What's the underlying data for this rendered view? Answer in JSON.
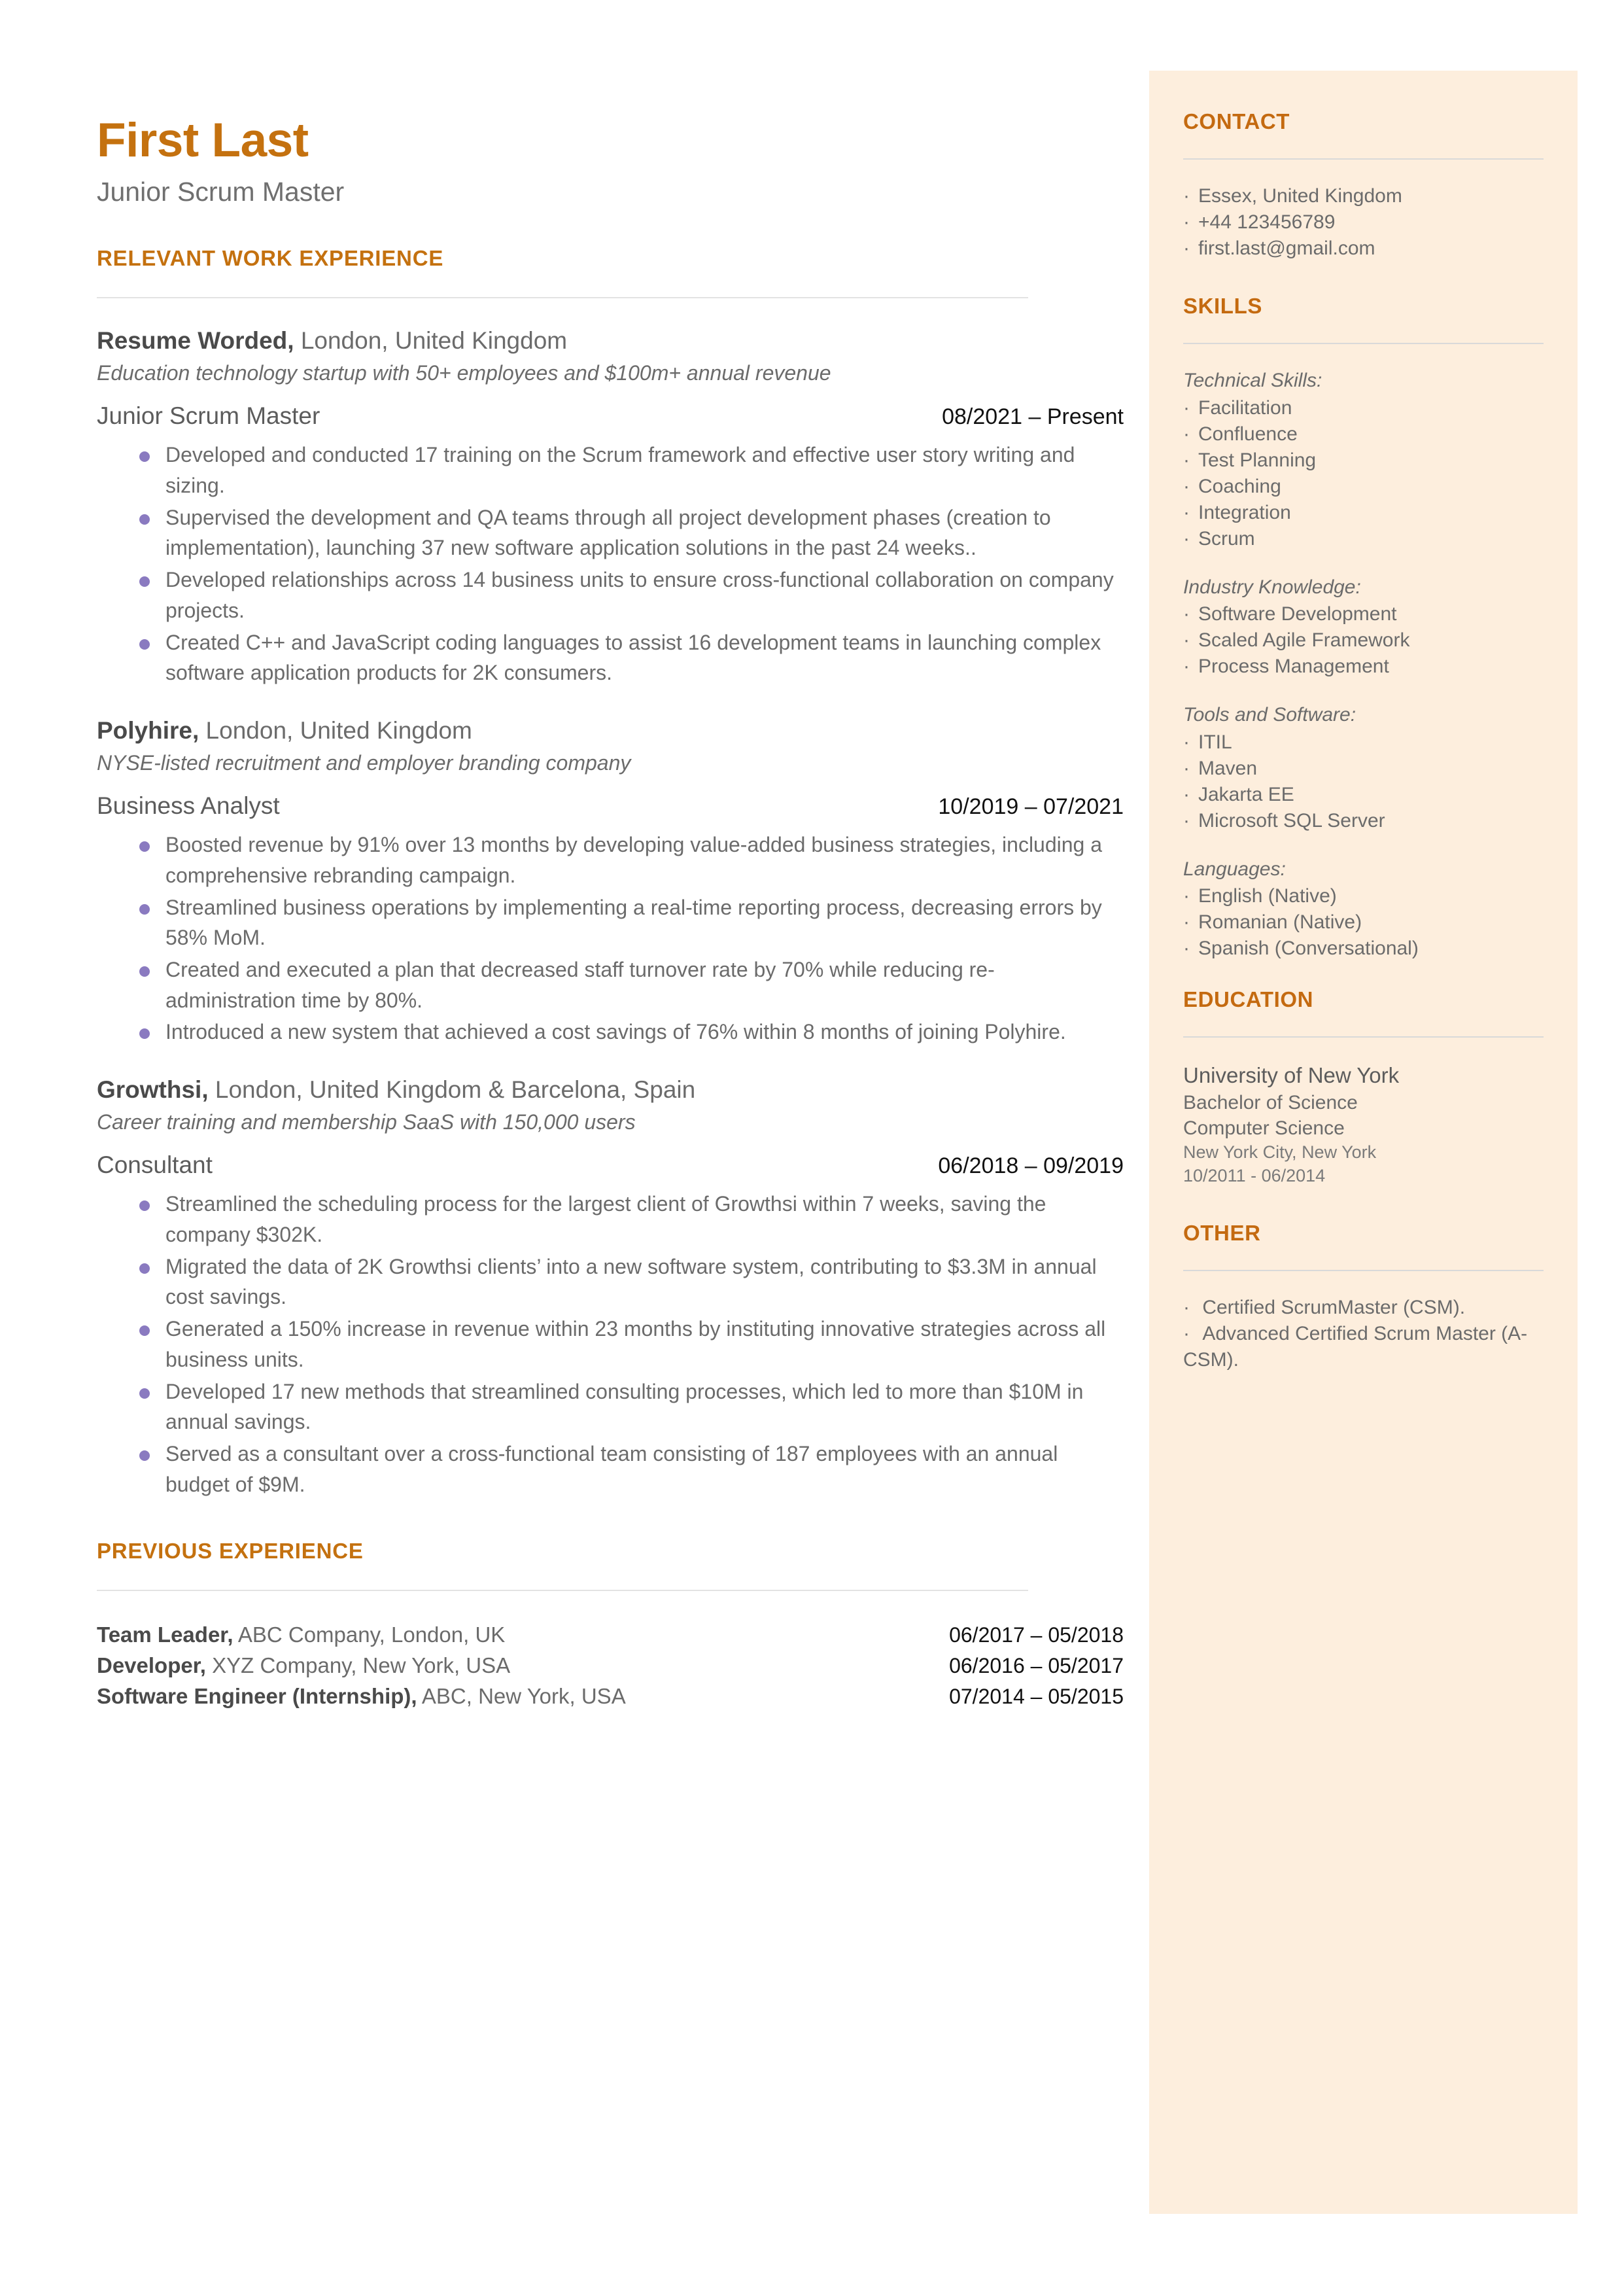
{
  "colors": {
    "accent": "#c4710f",
    "sidebar_bg": "#fdeedd",
    "bullet": "#8a7ac0",
    "body_text": "#6b6b6b",
    "date_text": "#111111"
  },
  "header": {
    "name": "First Last",
    "subtitle": "Junior Scrum Master"
  },
  "main": {
    "experience_heading": "RELEVANT WORK EXPERIENCE",
    "previous_heading": "PREVIOUS EXPERIENCE",
    "jobs": [
      {
        "company": "Resume Worded,",
        "location": "London, United Kingdom",
        "description": "Education technology startup with 50+ employees and $100m+ annual revenue",
        "title": "Junior Scrum Master",
        "dates": "08/2021 – Present",
        "bullets": [
          "Developed and conducted 17 training on the Scrum framework and effective user story writing and sizing.",
          "Supervised the development and QA teams through all project development phases (creation to implementation), launching 37 new software application solutions in the past 24 weeks..",
          "Developed relationships across 14 business units to ensure cross-functional collaboration on company projects.",
          "Created C++ and JavaScript coding languages to assist 16 development teams in launching complex software application products for 2K consumers."
        ]
      },
      {
        "company": "Polyhire,",
        "location": "London, United Kingdom",
        "description": "NYSE-listed recruitment and employer branding company",
        "title": "Business Analyst",
        "dates": "10/2019 – 07/2021",
        "bullets": [
          "Boosted revenue by 91% over 13 months by developing value-added business strategies, including a comprehensive rebranding campaign.",
          "Streamlined business operations by implementing a real-time reporting process, decreasing errors by 58% MoM.",
          "Created and executed a plan that decreased staff turnover rate by 70% while reducing re-administration time by 80%.",
          "Introduced a new system that achieved a cost savings of 76% within 8 months of joining Polyhire."
        ]
      },
      {
        "company": "Growthsi,",
        "location": "London, United Kingdom & Barcelona, Spain",
        "description": "Career training and membership SaaS with 150,000 users",
        "title": "Consultant",
        "dates": "06/2018 – 09/2019",
        "bullets": [
          "Streamlined the scheduling process for the largest client of Growthsi within 7 weeks, saving the company $302K.",
          "Migrated the data of 2K Growthsi clients’ into a new software system, contributing to $3.3M in annual cost savings.",
          "Generated a 150% increase in revenue within 23 months by instituting innovative strategies across all business units.",
          "Developed 17 new methods that streamlined consulting processes, which led to more than $10M in annual savings.",
          "Served as a consultant over a cross-functional team consisting of 187 employees with an annual budget of $9M."
        ]
      }
    ],
    "previous": [
      {
        "role": "Team Leader,",
        "rest": " ABC Company, London, UK",
        "dates": "06/2017 – 05/2018"
      },
      {
        "role": "Developer,",
        "rest": " XYZ Company, New York, USA",
        "dates": "06/2016 – 05/2017"
      },
      {
        "role": "Software Engineer (Internship),",
        "rest": " ABC, New York, USA",
        "dates": "07/2014 – 05/2015"
      }
    ]
  },
  "sidebar": {
    "contact": {
      "heading": "CONTACT",
      "items": [
        "Essex, United Kingdom",
        "+44 123456789",
        "first.last@gmail.com"
      ]
    },
    "skills": {
      "heading": "SKILLS",
      "groups": [
        {
          "label": "Technical Skills:",
          "items": [
            "Facilitation",
            "Confluence",
            "Test Planning",
            "Coaching",
            "Integration",
            "Scrum"
          ]
        },
        {
          "label": "Industry Knowledge:",
          "items": [
            "Software Development",
            "Scaled Agile Framework",
            "Process Management"
          ]
        },
        {
          "label": "Tools and Software:",
          "items": [
            "ITIL",
            "Maven",
            "Jakarta EE",
            "Microsoft SQL Server"
          ]
        },
        {
          "label": "Languages:",
          "items": [
            "English (Native)",
            "Romanian (Native)",
            "Spanish (Conversational)"
          ]
        }
      ]
    },
    "education": {
      "heading": "EDUCATION",
      "school": "University of New York",
      "degree": "Bachelor of Science",
      "field": "Computer Science",
      "location": "New York City, New York",
      "dates": "10/2011 - 06/2014"
    },
    "other": {
      "heading": "OTHER",
      "items": [
        "Certified ScrumMaster (CSM).",
        "Advanced Certified Scrum Master (A-CSM)."
      ]
    }
  }
}
